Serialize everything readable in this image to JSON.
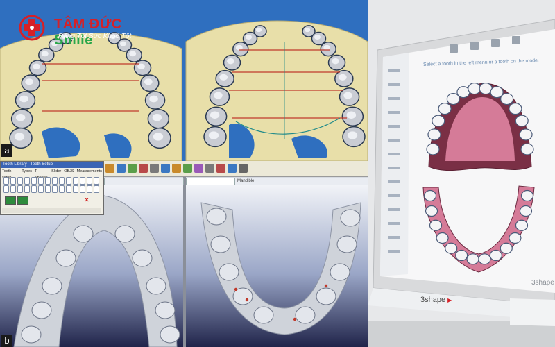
{
  "logo": {
    "name_red": "TÂM ĐỨC",
    "name_green": "Smile",
    "slogan": "Răng Tốt Sức Khoẻ Tốt"
  },
  "panel_labels": {
    "a": "a",
    "b": "b"
  },
  "software_b": {
    "tool_window_title": "Tooth Library - Teeth Setup",
    "tool_tabs": [
      "Tooth setup",
      "Types",
      "T-Shapes",
      "Slider",
      "OBJS",
      "Measurements"
    ],
    "left_view_title": "",
    "right_view_title": "Mandible"
  },
  "scanner_screen": {
    "instruction": "Select a tooth in the left menu or a tooth on the model",
    "screen_brand": "3shape",
    "monitor_brand": "3shape",
    "monitor_brand_mark": "▶"
  },
  "colors": {
    "model_bg_blue": "#2f6fbf",
    "bone_yellow": "#e8dfa9",
    "tooth_grey": "#c9ccd3",
    "measure_red": "#c0392b",
    "gum_pink": "#d57b98",
    "brand_red": "#d62027",
    "brand_green": "#29a74a"
  },
  "icons": [
    "logo-cross-icon",
    "toolbar-icons",
    "tooth-selection-icons"
  ]
}
